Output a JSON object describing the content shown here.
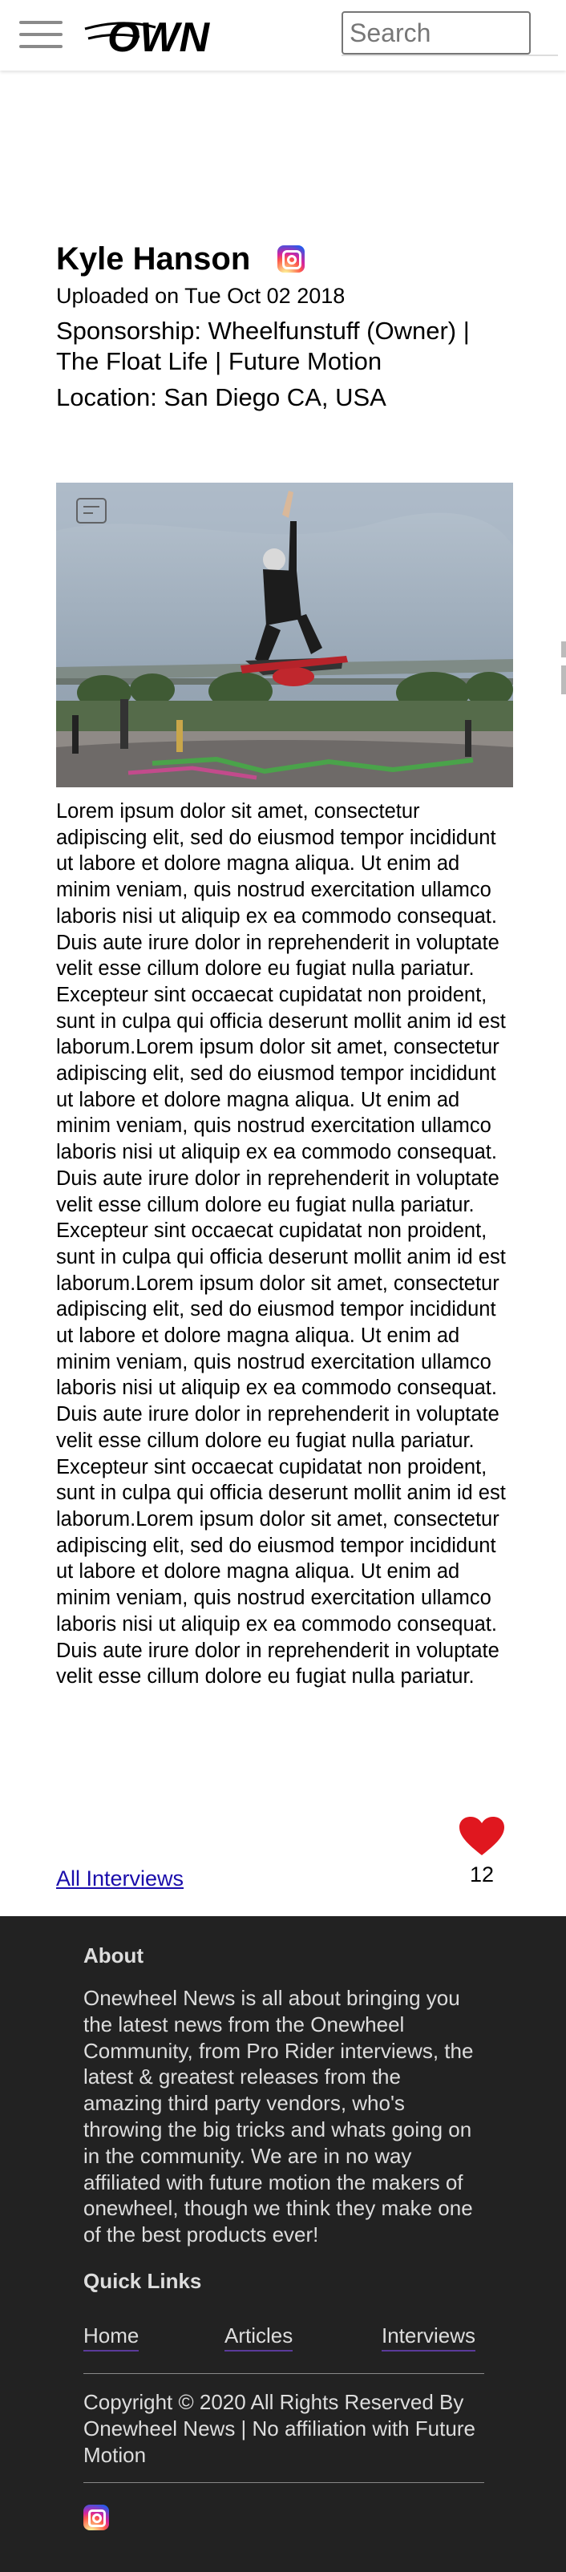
{
  "header": {
    "logo_text": "OWN",
    "menu_icon": "hamburger-icon",
    "search_placeholder": "Search"
  },
  "interview": {
    "name": "Kyle Hanson",
    "social_icon": "instagram-icon",
    "uploaded": "Uploaded on Tue Oct 02 2018",
    "sponsorship": "Sponsorship: Wheelfunstuff (Owner) | The Float Life | Future Motion",
    "location": "Location: San Diego CA, USA",
    "photo_alt": "Rider performing a jump on a Onewheel at a skatepark",
    "body": "Lorem ipsum dolor sit amet, consectetur adipiscing elit, sed do eiusmod tempor incididunt ut labore et dolore magna aliqua. Ut enim ad minim veniam, quis nostrud exercitation ullamco laboris nisi ut aliquip ex ea commodo consequat. Duis aute irure dolor in reprehenderit in voluptate velit esse cillum dolore eu fugiat nulla pariatur. Excepteur sint occaecat cupidatat non proident, sunt in culpa qui officia deserunt mollit anim id est laborum.Lorem ipsum dolor sit amet, consectetur adipiscing elit, sed do eiusmod tempor incididunt ut labore et dolore magna aliqua. Ut enim ad minim veniam, quis nostrud exercitation ullamco laboris nisi ut aliquip ex ea commodo consequat. Duis aute irure dolor in reprehenderit in voluptate velit esse cillum dolore eu fugiat nulla pariatur. Excepteur sint occaecat cupidatat non proident, sunt in culpa qui officia deserunt mollit anim id est laborum.Lorem ipsum dolor sit amet, consectetur adipiscing elit, sed do eiusmod tempor incididunt ut labore et dolore magna aliqua. Ut enim ad minim veniam, quis nostrud exercitation ullamco laboris nisi ut aliquip ex ea commodo consequat. Duis aute irure dolor in reprehenderit in voluptate velit esse cillum dolore eu fugiat nulla pariatur. Excepteur sint occaecat cupidatat non proident, sunt in culpa qui officia deserunt mollit anim id est laborum.Lorem ipsum dolor sit amet, consectetur adipiscing elit, sed do eiusmod tempor incididunt ut labore et dolore magna aliqua. Ut enim ad minim veniam, quis nostrud exercitation ullamco laboris nisi ut aliquip ex ea commodo consequat. Duis aute irure dolor in reprehenderit in voluptate velit esse cillum dolore eu fugiat nulla pariatur.",
    "likes": "12",
    "like_icon": "heart-icon",
    "all_interviews_link": "All Interviews"
  },
  "footer": {
    "about_heading": "About",
    "about_text": "Onewheel News is all about bringing you the latest news from the Onewheel Community, from Pro Rider interviews, the latest & greatest releases from the amazing third party vendors, who's throwing the big tricks and whats going on in the community. We are in no way affiliated with future motion the makers of onewheel, though we think they make one of the best products ever!",
    "quick_links_heading": "Quick Links",
    "links": [
      "Home",
      "Articles",
      "Interviews"
    ],
    "copyright": "Copyright © 2020 All Rights Reserved By Onewheel News | No affiliation with Future Motion",
    "social_icon": "instagram-icon"
  },
  "colors": {
    "heart": "#e0171f",
    "footer_bg": "#222222",
    "link": "#1a0dab",
    "footer_link_underline": "#5b3a9b"
  }
}
